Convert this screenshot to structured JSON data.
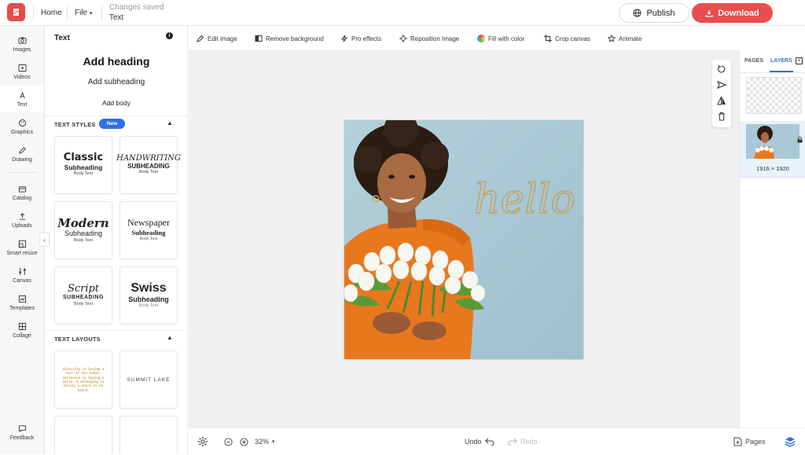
{
  "topbar": {
    "home_label": "Home",
    "file_label": "File",
    "save_status": "Changes saved",
    "doc_title": "Text",
    "publish_label": "Publish",
    "download_label": "Download"
  },
  "colors": {
    "accent_red": "#e84d4f",
    "accent_blue": "#2f6fe0",
    "canvas_bg": "#f0f0f0",
    "photo_bg": "#a9c9d6"
  },
  "nav": [
    {
      "label": "Images",
      "icon": "camera-icon"
    },
    {
      "label": "Videos",
      "icon": "video-icon"
    },
    {
      "label": "Text",
      "icon": "text-icon",
      "active": true
    },
    {
      "label": "Graphics",
      "icon": "palette-icon"
    },
    {
      "label": "Drawing",
      "icon": "pen-icon"
    },
    {
      "label": "Catalog",
      "icon": "catalog-icon"
    },
    {
      "label": "Uploads",
      "icon": "upload-icon"
    },
    {
      "label": "Smart resize",
      "icon": "resize-icon"
    },
    {
      "label": "Canvas",
      "icon": "sliders-icon"
    },
    {
      "label": "Templates",
      "icon": "templates-icon"
    },
    {
      "label": "Collage",
      "icon": "collage-icon"
    },
    {
      "label": "Feedback",
      "icon": "feedback-icon"
    }
  ],
  "panel": {
    "title": "Text",
    "add_heading": "Add heading",
    "add_subheading": "Add subheading",
    "add_body": "Add body",
    "styles_header": "TEXT STYLES",
    "new_badge": "New",
    "layouts_header": "TEXT LAYOUTS",
    "styles": [
      {
        "heading": "Classic",
        "sub": "Subheading",
        "body": "Body Text"
      },
      {
        "heading": "HANDWRITING",
        "sub": "SUBHEADING",
        "body": "Body Text"
      },
      {
        "heading": "Modern",
        "sub": "Subheading",
        "body": "Body Text"
      },
      {
        "heading": "Newspaper",
        "sub": "Subheading",
        "body": "Body Text"
      },
      {
        "heading": "Script",
        "sub": "SUBHEADING",
        "body": "Body Text"
      },
      {
        "heading": "Swiss",
        "sub": "Subheading",
        "body": "Body Text"
      }
    ],
    "layouts": [
      {
        "text": "diversity is having a seat at the table. inclusion is having a voice, & belonging is having a voice to be heard."
      },
      {
        "text": "SUMMIT LAKE"
      }
    ]
  },
  "toolbar": [
    {
      "label": "Edit image",
      "icon": "edit-image-icon"
    },
    {
      "label": "Remove background",
      "icon": "remove-bg-icon"
    },
    {
      "label": "Pro effects",
      "icon": "effects-icon"
    },
    {
      "label": "Reposition Image",
      "icon": "reposition-icon"
    },
    {
      "label": "Fill with color",
      "icon": "color-wheel-icon"
    },
    {
      "label": "Crop canvas",
      "icon": "crop-icon"
    },
    {
      "label": "Animate",
      "icon": "star-icon"
    }
  ],
  "canvas": {
    "overlay_text": "hello"
  },
  "bottombar": {
    "zoom": "32%",
    "undo_label": "Undo",
    "redo_label": "Redo",
    "pages_label": "Pages"
  },
  "rightpanel": {
    "tab_pages": "PAGES",
    "tab_layers": "LAYERS",
    "dimensions": "1916 × 1920"
  }
}
